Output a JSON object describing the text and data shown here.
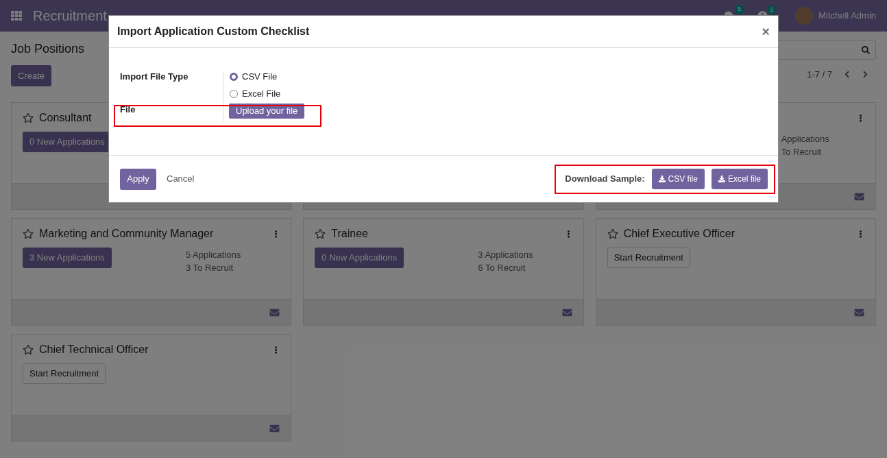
{
  "navbar": {
    "app_title": "Recruitment",
    "messages_badge": "5",
    "activities_badge": "2",
    "user": "Mitchell Admin"
  },
  "control_panel": {
    "title": "Job Positions",
    "create_button": "Create",
    "pager": "1-7 / 7"
  },
  "cards": [
    {
      "kind": "job",
      "title": "Consultant",
      "button": {
        "label": "0 New Applications",
        "kind": "primary"
      }
    },
    {
      "kind": "job"
    },
    {
      "kind": "job",
      "stats": [
        {
          "label": "Applications"
        },
        {
          "label": "To Recruit"
        }
      ],
      "menu": true,
      "mail": true
    },
    {
      "kind": "job",
      "title": "Marketing and Community Manager",
      "button": {
        "label": "3 New Applications",
        "kind": "primary"
      },
      "stats": [
        {
          "count": "5",
          "label": "Applications"
        },
        {
          "count": "3",
          "label": "To Recruit"
        }
      ],
      "menu": true,
      "mail": true
    },
    {
      "kind": "job",
      "title": "Trainee",
      "button": {
        "label": "0 New Applications",
        "kind": "primary"
      },
      "stats": [
        {
          "count": "3",
          "label": "Applications"
        },
        {
          "count": "6",
          "label": "To Recruit"
        }
      ],
      "menu": true,
      "mail": true
    },
    {
      "kind": "job",
      "title": "Chief Executive Officer",
      "button": {
        "label": "Start Recruitment",
        "kind": "secondary"
      },
      "menu": true,
      "mail": true
    },
    {
      "kind": "job",
      "title": "Chief Technical Officer",
      "button": {
        "label": "Start Recruitment",
        "kind": "secondary"
      },
      "menu": true,
      "mail": true
    }
  ],
  "dialog": {
    "title": "Import Application Custom Checklist",
    "close": "×",
    "file_type_label": "Import File Type",
    "file_types": [
      {
        "label": "CSV File",
        "selected": true
      },
      {
        "label": "Excel File",
        "selected": false
      }
    ],
    "file_label": "File",
    "upload_button": "Upload your file",
    "apply_button": "Apply",
    "cancel_button": "Cancel",
    "download_label": "Download Sample:",
    "download_buttons": [
      "CSV file",
      "Excel file"
    ]
  }
}
